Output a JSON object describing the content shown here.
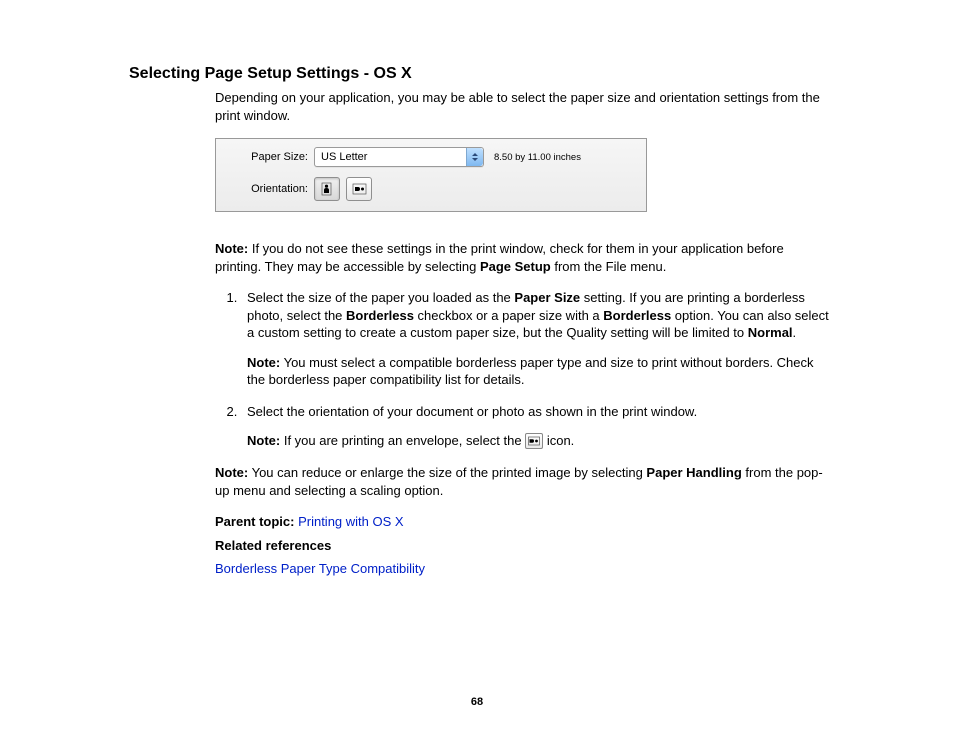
{
  "heading": "Selecting Page Setup Settings - OS X",
  "intro": "Depending on your application, you may be able to select the paper size and orientation settings from the print window.",
  "ui": {
    "paper_size_label": "Paper Size:",
    "paper_size_value": "US Letter",
    "dimensions": "8.50 by 11.00 inches",
    "orientation_label": "Orientation:"
  },
  "note1_label": "Note:",
  "note1_a": " If you do not see these settings in the print window, check for them in your application before printing. They may be accessible by selecting ",
  "note1_b": "Page Setup",
  "note1_c": " from the File menu.",
  "step1_a": "Select the size of the paper you loaded as the ",
  "step1_b": "Paper Size",
  "step1_c": " setting. If you are printing a borderless photo, select the ",
  "step1_d": "Borderless",
  "step1_e": " checkbox or a paper size with a ",
  "step1_f": "Borderless",
  "step1_g": " option. You can also select a custom setting to create a custom paper size, but the Quality setting will be limited to ",
  "step1_h": "Normal",
  "step1_i": ".",
  "step1_note_label": "Note:",
  "step1_note": " You must select a compatible borderless paper type and size to print without borders. Check the borderless paper compatibility list for details.",
  "step2": "Select the orientation of your document or photo as shown in the print window.",
  "step2_note_label": "Note:",
  "step2_note_a": " If you are printing an envelope, select the ",
  "step2_note_b": " icon.",
  "note3_label": "Note:",
  "note3_a": " You can reduce or enlarge the size of the printed image by selecting ",
  "note3_b": "Paper Handling",
  "note3_c": " from the pop-up menu and selecting a scaling option.",
  "parent_topic_label": "Parent topic: ",
  "parent_topic_link": "Printing with OS X",
  "related_refs_label": "Related references",
  "related_ref_link": "Borderless Paper Type Compatibility",
  "page_number": "68"
}
